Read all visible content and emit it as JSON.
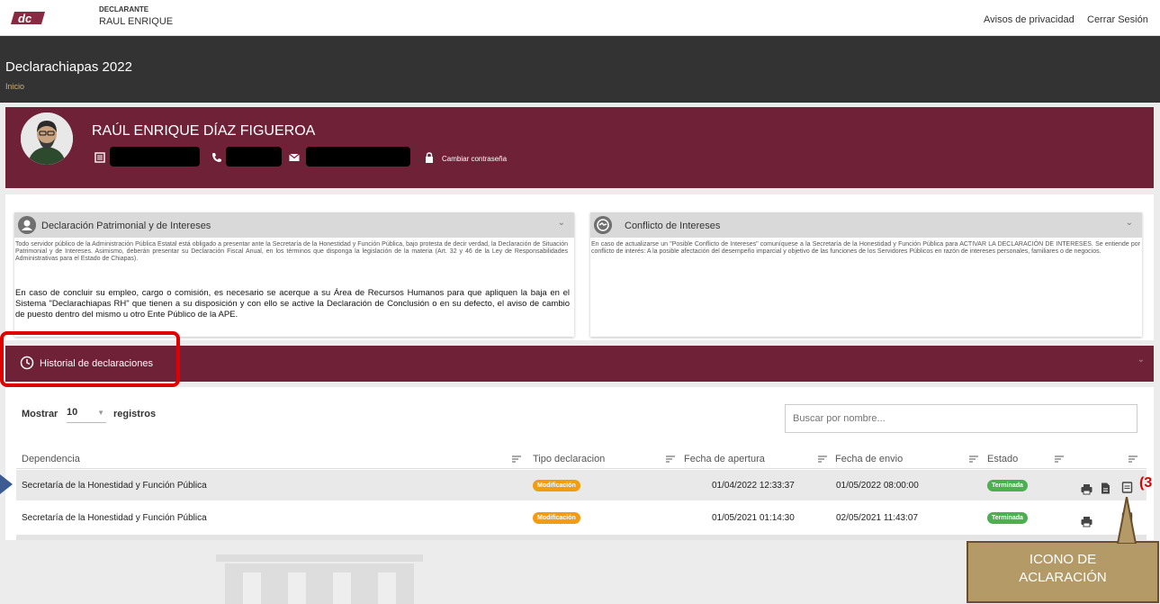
{
  "header": {
    "declarante_label": "DECLARANTE",
    "declarante_name": "RAUL ENRIQUE",
    "logo_text": "dc",
    "privacy_link": "Avisos de privacidad",
    "logout_link": "Cerrar Sesión"
  },
  "titlebar": {
    "title": "Declarachiapas 2022",
    "breadcrumb": "Inicio"
  },
  "profile": {
    "name": "RAÚL ENRIQUE DÍAZ FIGUEROA",
    "change_password": "Cambiar contraseña"
  },
  "cards": {
    "patrimonial": {
      "title": "Declaración Patrimonial y de Intereses",
      "text": "Todo servidor público de la Administración Pública Estatal está obligado a presentar ante la Secretaría de la Honestidad y Función Pública, bajo protesta de decir verdad, la Declaración de Situación Patrimonial y de Intereses. Asimismo, deberán presentar su Declaración Fiscal Anual, en los términos que disponga la legislación de la materia (Art. 32 y 46 de la Ley de Responsabilidades Administrativas para el Estado de Chiapas).",
      "notice": "En caso de concluir su empleo, cargo o comisión, es necesario se acerque a su Área de Recursos Humanos para que apliquen la baja en el Sistema \"Declarachiapas RH\" que tienen a su disposición y con ello se active la Declaración de Conclusión o en su defecto, el aviso de cambio de puesto dentro del mismo u otro Ente Público de la APE."
    },
    "conflicto": {
      "title": "Conflicto de Intereses",
      "text": "En caso de actualizarse un \"Posible Conflicto de Intereses\" comuníquese a la Secretaría de la Honestidad y Función Pública para ACTIVAR LA DECLARACIÓN DE INTERESES. Se entiende por conflicto de interés: A la posible afectación del desempeño imparcial y objetivo de las funciones de los Servidores Públicos en razón de intereses personales, familiares o de negocios."
    }
  },
  "history": {
    "title": "Historial de declaraciones",
    "show_label": "Mostrar",
    "show_value": "10",
    "records_label": "registros",
    "search_placeholder": "Buscar por nombre...",
    "columns": [
      "Dependencia",
      "Tipo declaracion",
      "Fecha de apertura",
      "Fecha de envio",
      "Estado"
    ],
    "rows": [
      {
        "dependencia": "Secretaría de la Honestidad y Función Pública",
        "tipo": "Modificación",
        "apertura": "01/04/2022 12:33:37",
        "envio": "01/05/2022 08:00:00",
        "estado": "Terminada"
      },
      {
        "dependencia": "Secretaría de la Honestidad y Función Pública",
        "tipo": "Modificación",
        "apertura": "01/05/2021 01:14:30",
        "envio": "02/05/2021 11:43:07",
        "estado": "Terminada"
      }
    ]
  },
  "annotations": {
    "callout_line1": "ICONO DE",
    "callout_line2": "ACLARACIÓN",
    "number": "(3"
  },
  "colors": {
    "brand": "#6f2137",
    "dark": "#333333",
    "badge_orange": "#f39c12",
    "badge_green": "#4caf50",
    "callout": "#b39a66",
    "highlight_red": "#e00000"
  }
}
